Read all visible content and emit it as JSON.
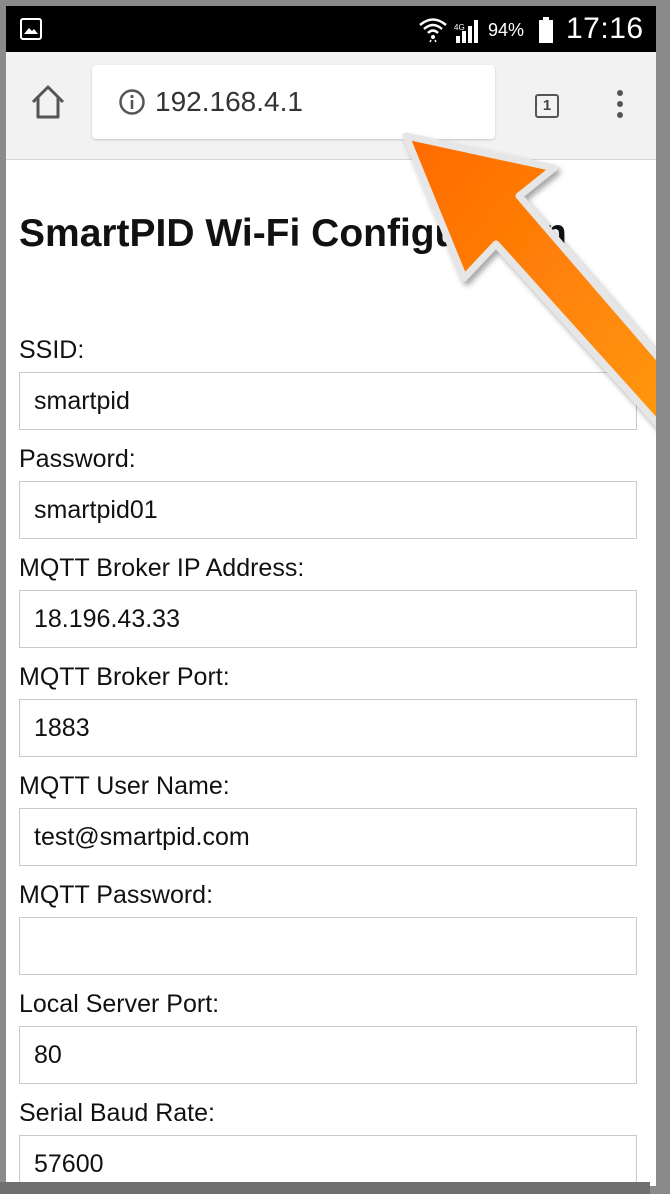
{
  "status_bar": {
    "battery_percent": "94%",
    "time": "17:16",
    "icons": [
      "gallery-icon",
      "wifi-icon",
      "signal-icon",
      "battery-icon"
    ]
  },
  "browser": {
    "url": "192.168.4.1",
    "tab_count": "1",
    "icons": [
      "home-icon",
      "info-icon",
      "tabs-icon",
      "menu-icon"
    ]
  },
  "page": {
    "title": "SmartPID Wi-Fi Configuration",
    "fields": [
      {
        "label": "SSID:",
        "value": "smartpid"
      },
      {
        "label": "Password:",
        "value": "smartpid01"
      },
      {
        "label": "MQTT Broker IP Address:",
        "value": "18.196.43.33"
      },
      {
        "label": "MQTT Broker Port:",
        "value": "1883"
      },
      {
        "label": "MQTT User Name:",
        "value": "test@smartpid.com"
      },
      {
        "label": "MQTT Password:",
        "value": ""
      },
      {
        "label": "Local Server Port:",
        "value": "80"
      },
      {
        "label": "Serial Baud Rate:",
        "value": "57600"
      }
    ]
  },
  "annotation": {
    "arrow_color": "#ff7a00",
    "arrow_points_to": "url-box"
  }
}
